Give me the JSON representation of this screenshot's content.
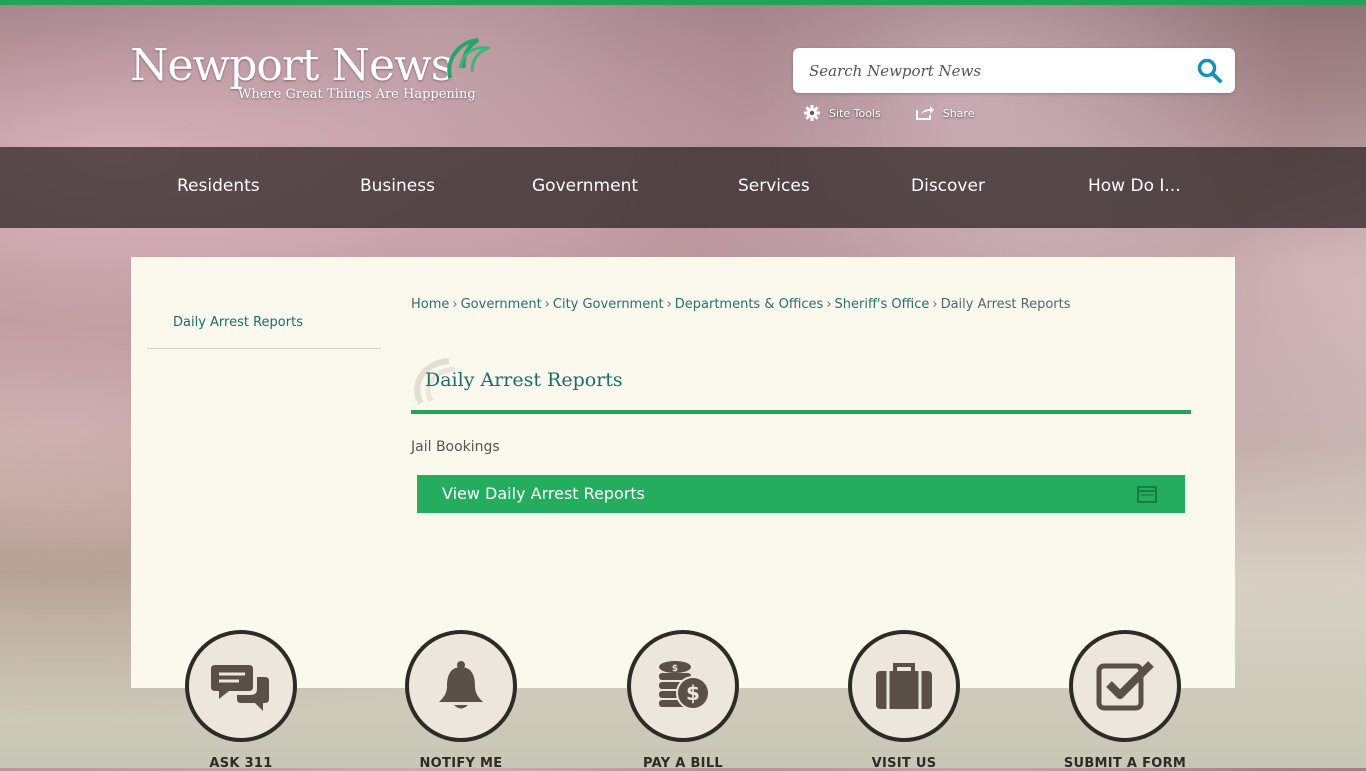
{
  "header": {
    "logo_main": "Newport News",
    "logo_tagline": "Where Great Things Are Happening",
    "search_placeholder": "Search Newport News",
    "tools": {
      "site_tools": "Site Tools",
      "share": "Share"
    }
  },
  "nav": {
    "items": [
      "Residents",
      "Business",
      "Government",
      "Services",
      "Discover",
      "How Do I..."
    ]
  },
  "sidebar": {
    "items": [
      "Daily Arrest Reports"
    ]
  },
  "breadcrumb": {
    "items": [
      "Home",
      "Government",
      "City Government",
      "Departments & Offices",
      "Sheriff's Office"
    ],
    "current": "Daily Arrest Reports",
    "separator": "›"
  },
  "main": {
    "title": "Daily Arrest Reports",
    "subtitle": "Jail Bookings",
    "button": "View Daily Arrest Reports"
  },
  "quick_links": [
    {
      "label": "ASK 311",
      "icon": "chat-icon"
    },
    {
      "label": "NOTIFY ME",
      "icon": "bell-icon"
    },
    {
      "label": "PAY A BILL",
      "icon": "coins-icon"
    },
    {
      "label": "VISIT US",
      "icon": "briefcase-icon"
    },
    {
      "label": "SUBMIT A FORM",
      "icon": "checkbox-icon"
    }
  ],
  "colors": {
    "accent_green": "#23a35a",
    "teal_text": "#1e6b6e",
    "dark_brown": "#2e2a26"
  }
}
